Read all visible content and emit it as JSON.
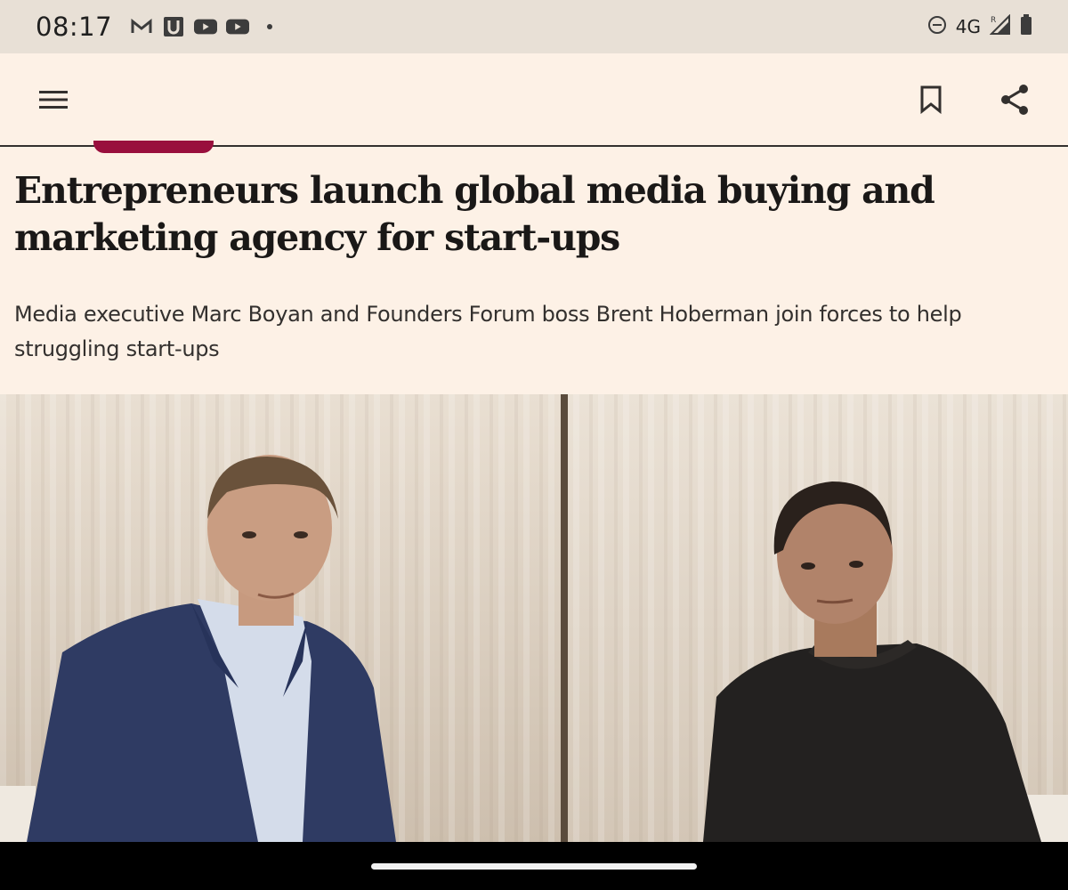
{
  "status_bar": {
    "time": "08:17",
    "notifications": [
      "gmail-icon",
      "u-app-icon",
      "youtube-icon",
      "youtube-icon"
    ],
    "network": "4G"
  },
  "app_bar": {
    "menu_icon": "hamburger-menu-icon",
    "bookmark_icon": "bookmark-icon",
    "share_icon": "share-icon"
  },
  "article": {
    "headline": "Entrepreneurs launch global media buying and marketing agency for start-ups",
    "standfirst": "Media executive Marc Boyan and Founders Forum boss Brent Hoberman join forces to help struggling start-ups"
  },
  "colors": {
    "background": "#fdf1e6",
    "accent": "#990f3d",
    "status_bar": "#e8e0d6"
  }
}
